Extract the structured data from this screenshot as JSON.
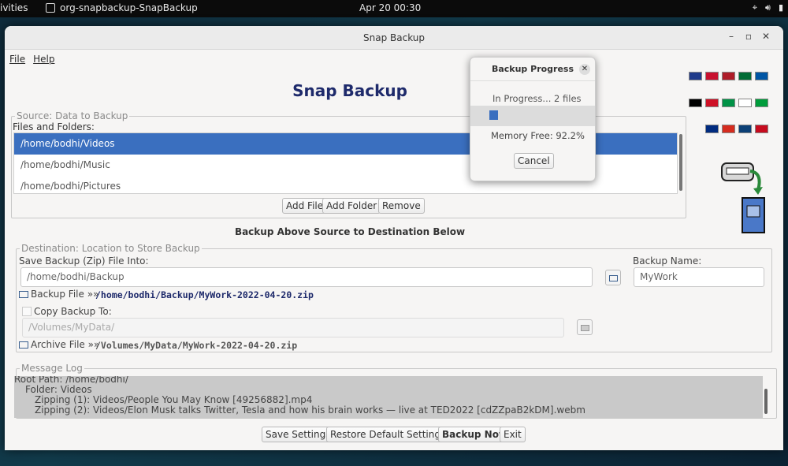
{
  "topbar": {
    "activities": "ivities",
    "app_name": "org-snapbackup-SnapBackup",
    "clock": "Apr 20  00:30"
  },
  "window": {
    "title": "Snap Backup",
    "menu": [
      "File",
      "Help"
    ],
    "app_title": "Snap Backup"
  },
  "source": {
    "legend": "Source: Data to Backup",
    "files_label": "Files and Folders:",
    "items": [
      "/home/bodhi/Videos",
      "/home/bodhi/Music",
      "/home/bodhi/Pictures"
    ],
    "selected_index": 0,
    "buttons": {
      "add_file": "Add File",
      "add_folder": "Add Folder",
      "remove": "Remove"
    }
  },
  "section_title": "Backup Above Source to Destination Below",
  "destination": {
    "legend": "Destination: Location to Store Backup",
    "save_label": "Save Backup (Zip) File Into:",
    "save_path": "/home/bodhi/Backup",
    "backup_name_label": "Backup Name:",
    "backup_name": "MyWork",
    "backup_file_label": "Backup File »»",
    "backup_file_path": "/home/bodhi/Backup/MyWork-2022-04-20.zip",
    "copy_label": "Copy Backup To:",
    "copy_path": "/Volumes/MyData/",
    "archive_file_label": "Archive File »»",
    "archive_file_path": "/Volumes/MyData/MyWork-2022-04-20.zip"
  },
  "log": {
    "legend": "Message Log",
    "lines": [
      "Root Path: /home/bodhi/",
      "Folder: Videos",
      "Zipping (1): Videos/People You May Know [49256882].mp4",
      "Zipping (2): Videos/Elon Musk talks Twitter, Tesla and how his brain works — live at TED2022 [cdZZpaB2kDM].webm"
    ]
  },
  "bottom_buttons": {
    "save_settings": "Save Settings",
    "restore": "Restore Default Settings",
    "backup_now": "Backup Now",
    "exit": "Exit"
  },
  "dialog": {
    "title": "Backup Progress",
    "progress_text": "In Progress... 2 files",
    "progress_fraction": 0.07,
    "memory": "Memory Free: 92.2%",
    "cancel": "Cancel"
  },
  "flag_colors": [
    [
      "#1f3a8a",
      "#c8102e",
      "#ae1c28",
      "#006c35",
      "#0055a4"
    ],
    [
      "#000000",
      "#ce1126",
      "#009246",
      "#ffffff",
      "#009c3b"
    ],
    [
      "#002b7f",
      "#d52b1e",
      "#0c4076",
      "#c60b1e"
    ]
  ]
}
